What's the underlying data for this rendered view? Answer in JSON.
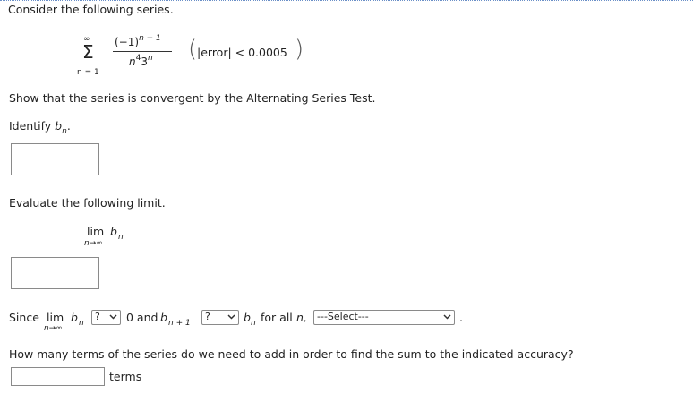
{
  "prompt": "Consider the following series.",
  "series": {
    "sigma": "Σ",
    "upper": "∞",
    "lower": "n = 1",
    "numerator": "(−1)",
    "num_exp": "n − 1",
    "denominator_n": "n",
    "denominator_exp1": "4",
    "denominator_3": "3",
    "denominator_exp2": "n",
    "error_open": "(",
    "error_text": "|error| < 0.0005",
    "error_close": ")"
  },
  "instruction": "Show that the series is convergent by the Alternating Series Test.",
  "identify": {
    "text": "Identify",
    "var": "b",
    "sub": "n",
    "tail": "."
  },
  "evaluate": "Evaluate the following limit.",
  "limit": {
    "lim": "lim",
    "sub": "n→∞",
    "var": "b",
    "var_sub": "n"
  },
  "since_line": {
    "since": "Since",
    "lim": "lim",
    "lim_sub": "n→∞",
    "b": "b",
    "b_sub": "n",
    "select1": "?",
    "zero_and": "0 and",
    "b2": "b",
    "b2_sub": "n + 1",
    "select2": "?",
    "b3": "b",
    "b3_sub": "n",
    "for_all": "for all",
    "n": "n,",
    "select3": "---Select---",
    "period": "."
  },
  "question": "How many terms of the series do we need to add in order to find the sum to the indicated accuracy?",
  "terms_label": "terms",
  "chevron": "chevron-down-icon"
}
